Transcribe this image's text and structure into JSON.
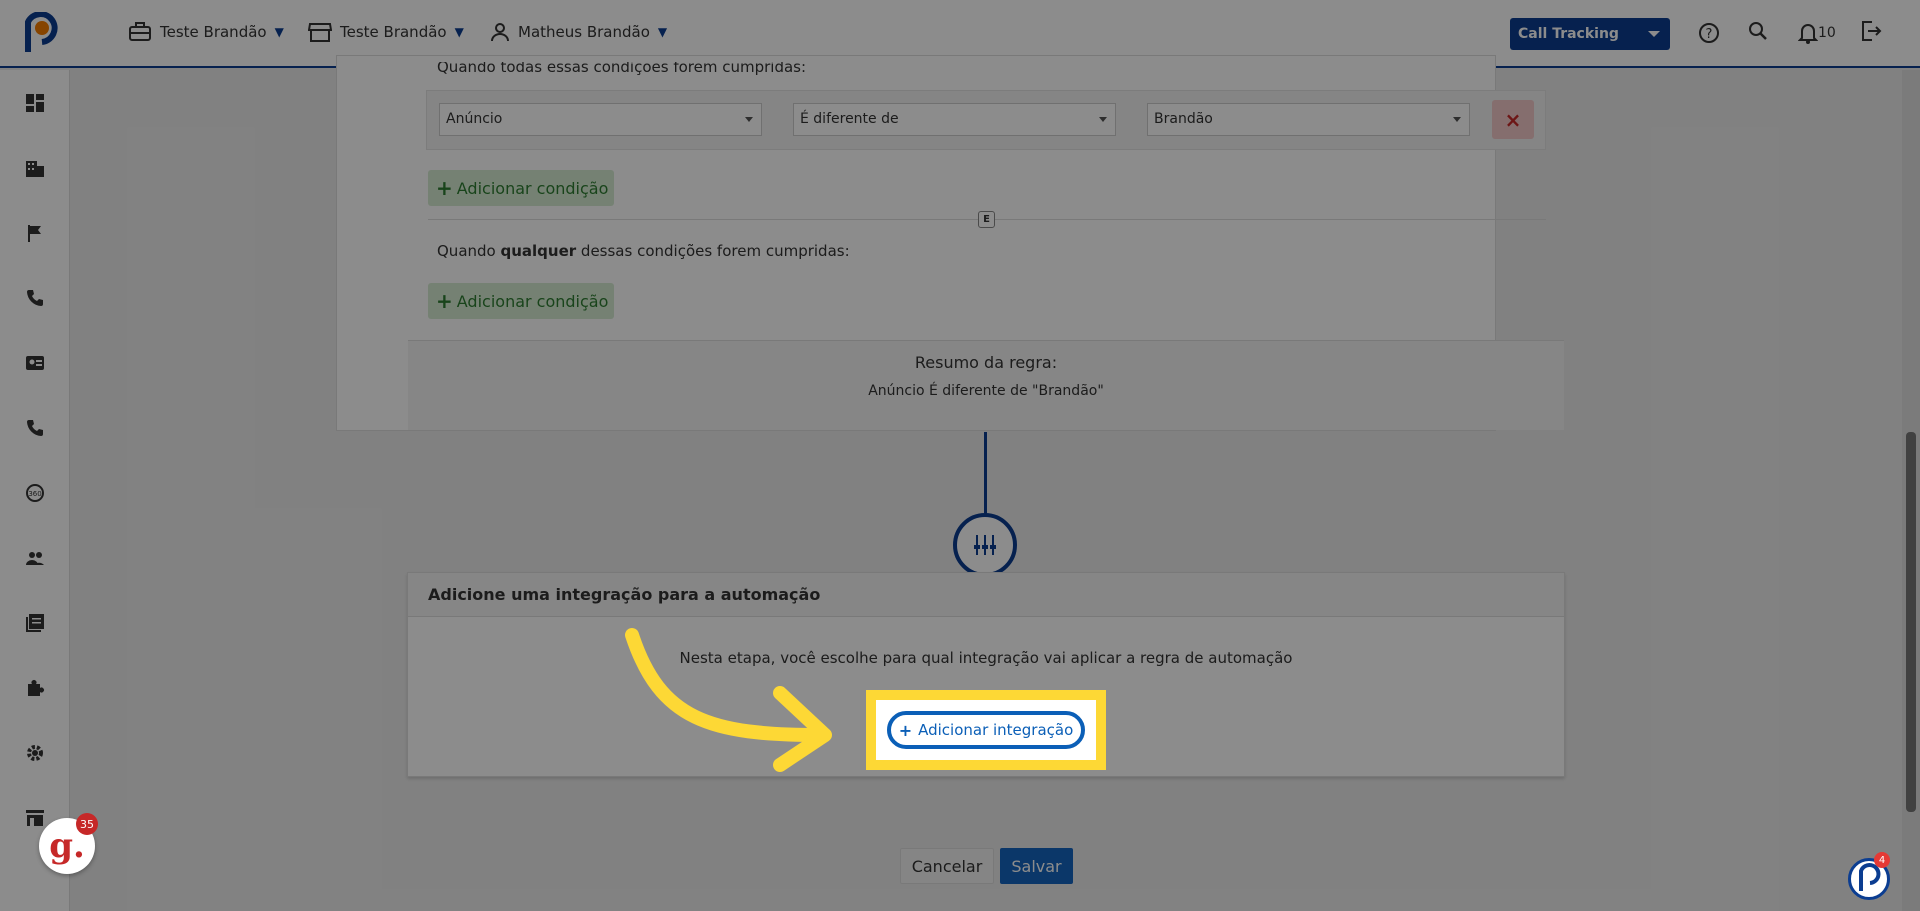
{
  "topbar": {
    "company": "Teste Brandão",
    "store": "Teste Brandão",
    "user": "Matheus Brandão",
    "product_select": "Call Tracking",
    "notifications_count": "10"
  },
  "rule": {
    "all_conditions_text": "Quando todas essas condições forem cumpridas:",
    "condition": {
      "field": "Anúncio",
      "operator": "É diferente de",
      "value": "Brandão"
    },
    "delete_glyph": "×",
    "add_condition_label": "Adicionar condição",
    "and_badge": "E",
    "any_prefix": "Quando ",
    "any_bold": "qualquer",
    "any_suffix": " dessas condições forem cumpridas:",
    "summary_title": "Resumo da regra:",
    "summary_text": "Anúncio É diferente de \"Brandão\""
  },
  "integration": {
    "title": "Adicione uma integração para a automação",
    "description": "Nesta etapa, você escolhe para qual integração vai aplicar a regra de automação",
    "add_label": "Adicionar integração"
  },
  "actions": {
    "cancel": "Cancelar",
    "save": "Salvar"
  },
  "widgets": {
    "g_letter": "g.",
    "g_badge": "35",
    "p_badge": "4"
  },
  "colors": {
    "brand": "#0b3d91",
    "highlight": "#fdd835",
    "save": "#1565c0"
  }
}
